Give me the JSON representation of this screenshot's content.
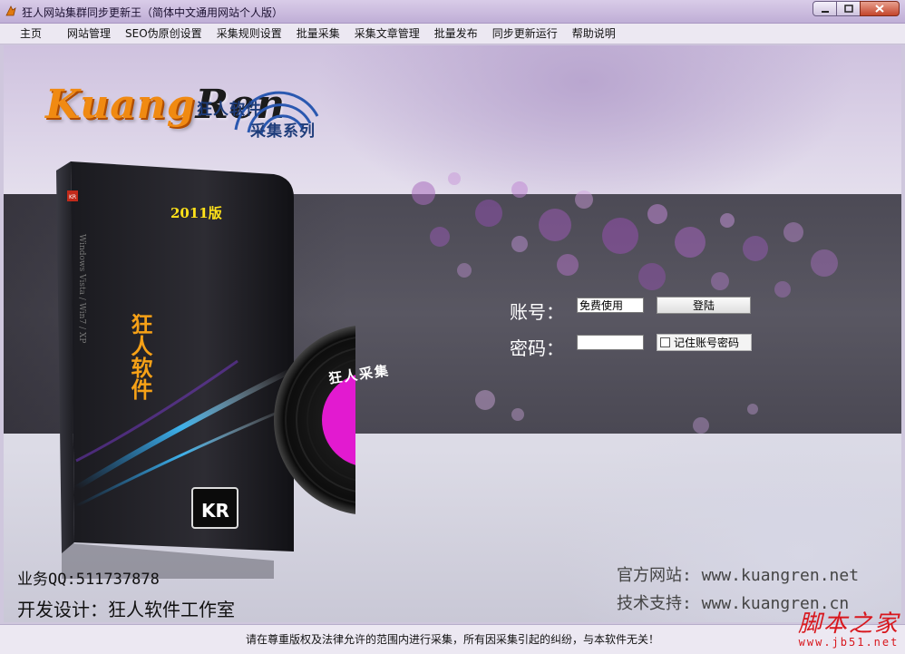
{
  "window": {
    "title": "狂人网站集群同步更新王（简体中文通用网站个人版）",
    "icon": "app-logo-icon"
  },
  "menu": {
    "items": [
      "主页",
      "网站管理",
      "SEO伪原创设置",
      "采集规则设置",
      "批量采集",
      "采集文章管理",
      "批量发布",
      "同步更新运行",
      "帮助说明"
    ]
  },
  "splash": {
    "logo_text_a": "Kuang",
    "logo_text_b": "Ren",
    "logo_cn_1": "狂人软件",
    "logo_cn_2": "采集系列",
    "version": "2011版",
    "box_cn": "狂人软件",
    "disc_label": "狂人采集",
    "box_badge": "KR"
  },
  "login": {
    "username_label": "账号：",
    "username_value": "免费使用",
    "password_label": "密码：",
    "password_value": "",
    "login_button": "登陆",
    "remember_label": "记住账号密码",
    "remember_checked": false
  },
  "footer": {
    "qq": "业务QQ:511737878",
    "developer": "开发设计：狂人软件工作室",
    "official_site": "官方网站: www.kuangren.net",
    "support_site": "技术支持: www.kuangren.cn"
  },
  "status": {
    "text": "请在尊重版权及法律允许的范围内进行采集，所有因采集引起的纠纷，与本软件无关！"
  },
  "watermark": {
    "cn": "脚本之家",
    "url": "www.jb51.net"
  },
  "colors": {
    "accent_orange": "#f08a12",
    "version_yellow": "#ffe21a",
    "disc_magenta": "#e21ad0",
    "watermark_red": "#d8171d"
  }
}
